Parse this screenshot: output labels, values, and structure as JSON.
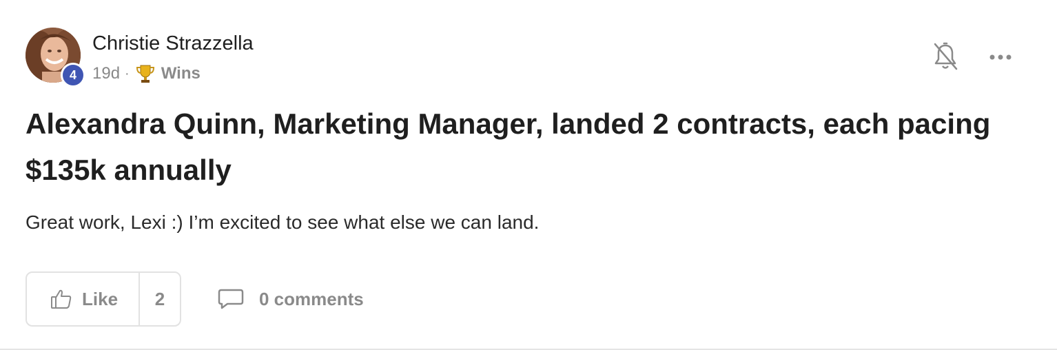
{
  "post": {
    "author": {
      "name": "Christie Strazzella",
      "level": "4"
    },
    "meta": {
      "time": "19d",
      "separator": "·",
      "category": "Wins",
      "category_icon": "trophy-icon"
    },
    "title": "Alexandra Quinn, Marketing Manager, landed 2 contracts, each pacing $135k annually",
    "body": "Great work, Lexi :) I’m excited to see what else we can land.",
    "actions": {
      "like_label": "Like",
      "like_count": "2",
      "comments_label": "0 comments"
    },
    "icons": {
      "notification": "bell-off-icon",
      "menu": "more-horizontal-icon",
      "like": "thumbs-up-icon",
      "comment": "comment-icon"
    },
    "colors": {
      "badge": "#3f55b3",
      "muted": "#8a8a8a",
      "text": "#1f1f1f"
    }
  }
}
